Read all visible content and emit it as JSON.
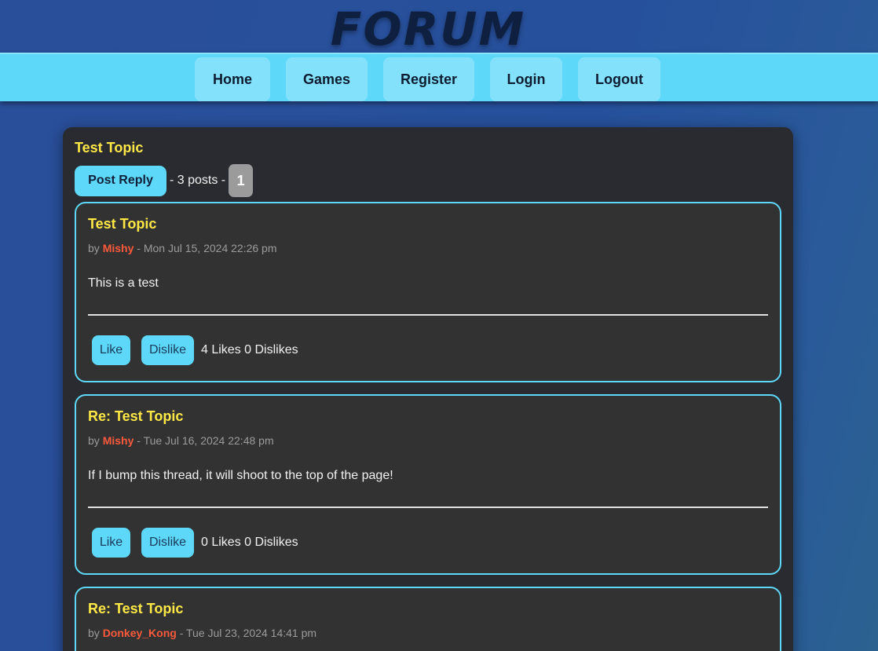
{
  "site": {
    "logo": "Forum"
  },
  "nav": {
    "items": [
      {
        "label": "Home"
      },
      {
        "label": "Games"
      },
      {
        "label": "Register"
      },
      {
        "label": "Login"
      },
      {
        "label": "Logout"
      }
    ]
  },
  "topic": {
    "title": "Test Topic",
    "post_reply_label": "Post Reply",
    "post_count": "- 3 posts -",
    "current_page": "1"
  },
  "posts": [
    {
      "title": "Test Topic",
      "by": "by",
      "author": "Mishy",
      "timestamp": "- Mon Jul 15, 2024 22:26 pm",
      "body": "This is a test",
      "like_label": "Like",
      "dislike_label": "Dislike",
      "votes": "4 Likes 0 Dislikes"
    },
    {
      "title": "Re: Test Topic",
      "by": "by",
      "author": "Mishy",
      "timestamp": "- Tue Jul 16, 2024 22:48 pm",
      "body": "If I bump this thread, it will shoot to the top of the page!",
      "like_label": "Like",
      "dislike_label": "Dislike",
      "votes": "0 Likes 0 Dislikes"
    },
    {
      "title": "Re: Test Topic",
      "by": "by",
      "author": "Donkey_Kong",
      "timestamp": "- Tue Jul 23, 2024 14:41 pm"
    }
  ],
  "colors": {
    "accent": "#5dd8f8",
    "title_yellow": "#ffe845",
    "author_red": "#ff5a3c",
    "panel": "#2a2b30",
    "post_bg": "#323232"
  }
}
